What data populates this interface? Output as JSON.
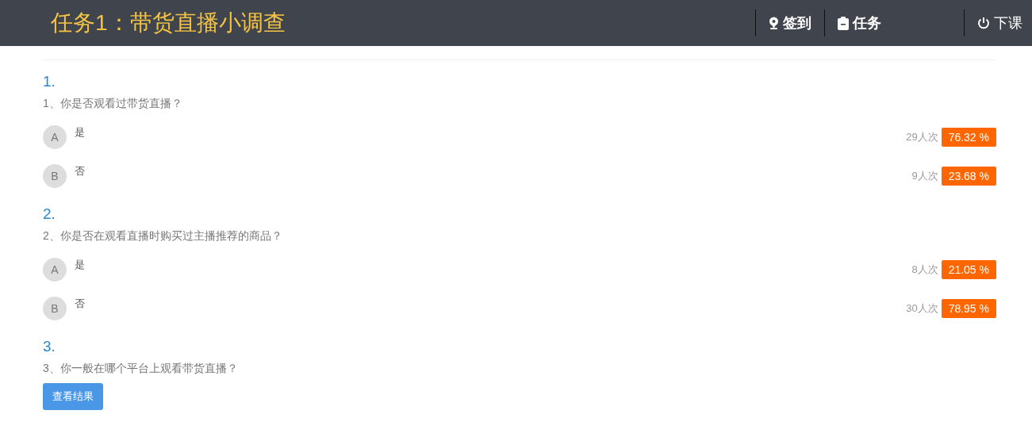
{
  "header": {
    "title": "任务1：带货直播小调查",
    "nav": [
      {
        "kind": "checkin",
        "label": "签到"
      },
      {
        "kind": "task",
        "label": "任务"
      },
      {
        "kind": "logout",
        "label": "下课"
      }
    ]
  },
  "questions": [
    {
      "number": "1.",
      "text": "1、你是否观看过带货直播？",
      "options": [
        {
          "letter": "A",
          "label": "是",
          "count": "29人次",
          "percent": "76.32 %"
        },
        {
          "letter": "B",
          "label": "否",
          "count": "9人次",
          "percent": "23.68 %"
        }
      ]
    },
    {
      "number": "2.",
      "text": "2、你是否在观看直播时购买过主播推荐的商品？",
      "options": [
        {
          "letter": "A",
          "label": "是",
          "count": "8人次",
          "percent": "21.05 %"
        },
        {
          "letter": "B",
          "label": "否",
          "count": "30人次",
          "percent": "78.95 %"
        }
      ]
    },
    {
      "number": "3.",
      "text": "3、你一般在哪个平台上观看带货直播？",
      "button": "查看结果"
    }
  ]
}
